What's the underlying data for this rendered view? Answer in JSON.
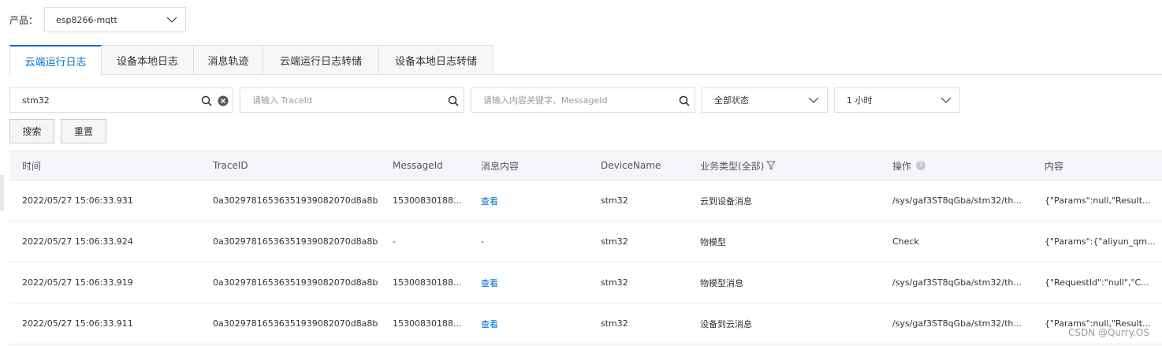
{
  "product": {
    "label": "产品：",
    "value": "esp8266-mqtt"
  },
  "tabs": [
    {
      "label": "云端运行日志",
      "active": true
    },
    {
      "label": "设备本地日志"
    },
    {
      "label": "消息轨迹"
    },
    {
      "label": "云端运行日志转储"
    },
    {
      "label": "设备本地日志转储"
    }
  ],
  "filters": {
    "device_search": {
      "value": "stm32"
    },
    "traceid": {
      "placeholder": "请输入 TraceId"
    },
    "keyword": {
      "placeholder": "请输入内容关键字、MessageId"
    },
    "status": {
      "value": "全部状态"
    },
    "timerange": {
      "value": "1 小时"
    }
  },
  "buttons": {
    "search": "搜索",
    "reset": "重置"
  },
  "table": {
    "headers": {
      "time": "时间",
      "traceid": "TraceID",
      "messageid": "MessageId",
      "content": "消息内容",
      "device": "DeviceName",
      "biztype": "业务类型(全部)",
      "action": "操作",
      "detail": "内容"
    },
    "rows": [
      {
        "time": "2022/05/27 15:06:33.931",
        "traceid": "0a30297816536351939082070d8a8b",
        "messageid": "15300830188...",
        "content": "查看",
        "device": "stm32",
        "biztype": "云到设备消息",
        "action": "/sys/gaf3ST8qGba/stm32/th...",
        "detail": "{\"Params\":null,\"Result..."
      },
      {
        "time": "2022/05/27 15:06:33.924",
        "traceid": "0a30297816536351939082070d8a8b",
        "messageid": "-",
        "content": "-",
        "device": "stm32",
        "biztype": "物模型",
        "action": "Check",
        "detail": "{\"Params\":{\"aliyun_qm..."
      },
      {
        "time": "2022/05/27 15:06:33.919",
        "traceid": "0a30297816536351939082070d8a8b",
        "messageid": "15300830188...",
        "content": "查看",
        "device": "stm32",
        "biztype": "物模型消息",
        "action": "/sys/gaf3ST8qGba/stm32/th...",
        "detail": "{\"RequestId\":\"null\",\"C..."
      },
      {
        "time": "2022/05/27 15:06:33.911",
        "traceid": "0a30297816536351939082070d8a8b",
        "messageid": "15300830188...",
        "content": "查看",
        "device": "stm32",
        "biztype": "设备到云消息",
        "action": "/sys/gaf3ST8qGba/stm32/th...",
        "detail": "{\"Params\":null,\"Result..."
      }
    ]
  },
  "watermark": "CSDN @Qurry.OS",
  "colors": {
    "accent": "#0070cc",
    "header_bg": "#f5f6fa",
    "border": "#dcdfe6"
  }
}
